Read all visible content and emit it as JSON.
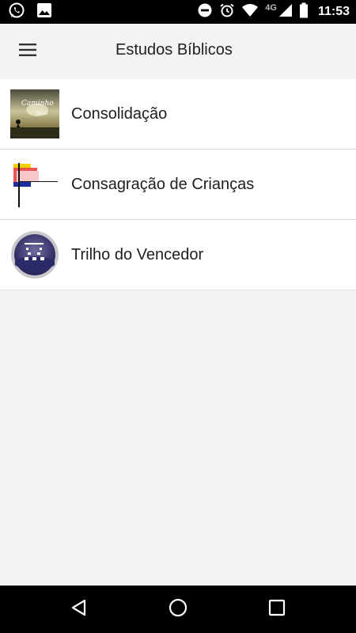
{
  "status_bar": {
    "time": "11:53",
    "network": "4G",
    "left_icons": [
      "whatsapp-icon",
      "image-icon"
    ],
    "right_icons": [
      "do-not-disturb-icon",
      "alarm-icon",
      "wifi-icon",
      "signal-icon",
      "battery-icon"
    ]
  },
  "app_bar": {
    "title": "Estudos Bíblicos",
    "menu_icon": "hamburger-menu-icon"
  },
  "list": {
    "items": [
      {
        "label": "Consolidação",
        "thumb_icon": "consolidacao-thumbnail"
      },
      {
        "label": "Consagração de Crianças",
        "thumb_icon": "consagracao-thumbnail"
      },
      {
        "label": "Trilho do Vencedor",
        "thumb_icon": "trilho-thumbnail"
      }
    ]
  },
  "nav_bar": {
    "buttons": [
      "back-icon",
      "home-icon",
      "recents-icon"
    ]
  },
  "colors": {
    "status_bar_bg": "#000000",
    "app_bar_bg": "#f3f3f3",
    "list_bg": "#ffffff",
    "divider": "#dcdcdc",
    "nav_bar_bg": "#000000"
  }
}
